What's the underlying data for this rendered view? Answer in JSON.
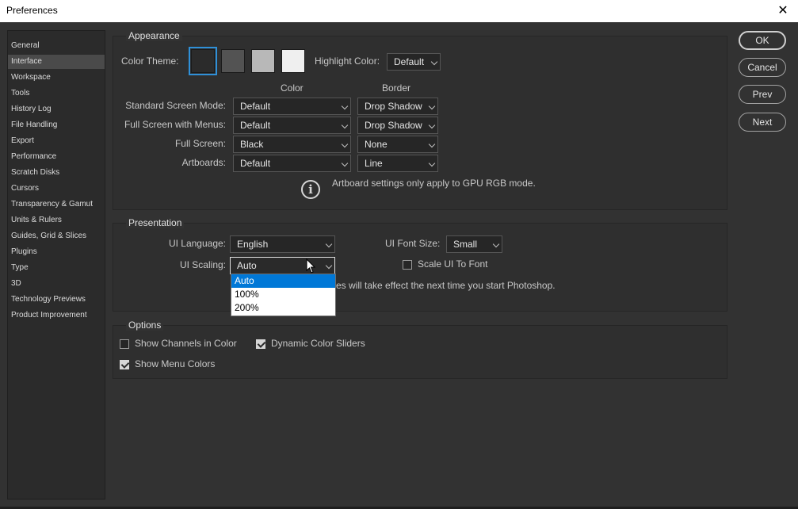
{
  "window": {
    "title": "Preferences"
  },
  "sidebar": {
    "items": [
      {
        "label": "General"
      },
      {
        "label": "Interface",
        "active": true
      },
      {
        "label": "Workspace"
      },
      {
        "label": "Tools"
      },
      {
        "label": "History Log"
      },
      {
        "label": "File Handling"
      },
      {
        "label": "Export"
      },
      {
        "label": "Performance"
      },
      {
        "label": "Scratch Disks"
      },
      {
        "label": "Cursors"
      },
      {
        "label": "Transparency & Gamut"
      },
      {
        "label": "Units & Rulers"
      },
      {
        "label": "Guides, Grid & Slices"
      },
      {
        "label": "Plugins"
      },
      {
        "label": "Type"
      },
      {
        "label": "3D"
      },
      {
        "label": "Technology Previews"
      },
      {
        "label": "Product Improvement"
      }
    ]
  },
  "buttons": {
    "ok": "OK",
    "cancel": "Cancel",
    "prev": "Prev",
    "next": "Next"
  },
  "appearance": {
    "title": "Appearance",
    "color_theme_label": "Color Theme:",
    "themes": [
      "#2b2b2b",
      "#535353",
      "#b8b8b8",
      "#efefef"
    ],
    "selected_theme_color": "#2b2b2b",
    "highlight_label": "Highlight Color:",
    "highlight_value": "Default",
    "col_color": "Color",
    "col_border": "Border",
    "rows": [
      {
        "label": "Standard Screen Mode:",
        "color": "Default",
        "border": "Drop Shadow"
      },
      {
        "label": "Full Screen with Menus:",
        "color": "Default",
        "border": "Drop Shadow"
      },
      {
        "label": "Full Screen:",
        "color": "Black",
        "border": "None"
      },
      {
        "label": "Artboards:",
        "color": "Default",
        "border": "Line"
      }
    ],
    "info_icon": "info-icon",
    "note": "Artboard settings only apply to GPU RGB mode."
  },
  "presentation": {
    "title": "Presentation",
    "ui_language_label": "UI Language:",
    "ui_language_value": "English",
    "ui_font_size_label": "UI Font Size:",
    "ui_font_size_value": "Small",
    "ui_scaling_label": "UI Scaling:",
    "ui_scaling_value": "Auto",
    "scale_ui_to_font_label": "Scale UI To Font",
    "scale_ui_to_font_checked": false,
    "note_visible": "es will take effect the next time you start Photoshop.",
    "scaling_options": [
      "Auto",
      "100%",
      "200%"
    ],
    "scaling_highlighted": "Auto"
  },
  "options": {
    "title": "Options",
    "show_channels_in_color": {
      "label": "Show Channels in Color",
      "checked": false
    },
    "dynamic_color_sliders": {
      "label": "Dynamic Color Sliders",
      "checked": true
    },
    "show_menu_colors": {
      "label": "Show Menu Colors",
      "checked": true
    }
  },
  "colors": {
    "accent": "#2f90d8",
    "highlight": "#0078d7",
    "panel": "#323232"
  }
}
